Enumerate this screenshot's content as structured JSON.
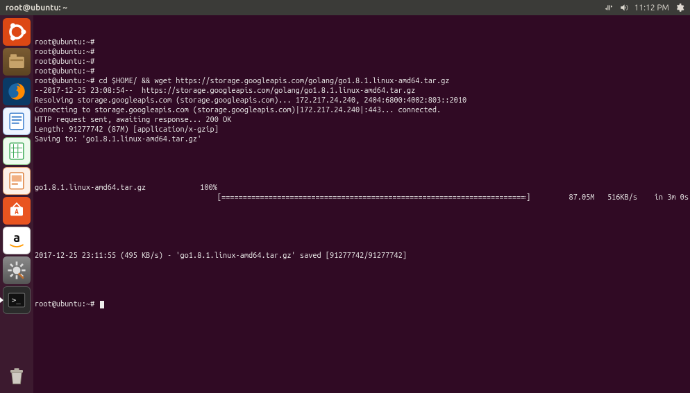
{
  "menubar": {
    "title": "root@ubuntu: ~",
    "time": "11:12 PM"
  },
  "terminal": {
    "prompt": "root@ubuntu:~#",
    "lines_before": [
      "root@ubuntu:~#",
      "root@ubuntu:~#",
      "root@ubuntu:~#",
      "root@ubuntu:~#",
      "root@ubuntu:~# cd $HOME/ && wget https://storage.googleapis.com/golang/go1.8.1.linux-amd64.tar.gz",
      "--2017-12-25 23:08:54--  https://storage.googleapis.com/golang/go1.8.1.linux-amd64.tar.gz",
      "Resolving storage.googleapis.com (storage.googleapis.com)... 172.217.24.240, 2404:6800:4002:803::2010",
      "Connecting to storage.googleapis.com (storage.googleapis.com)|172.217.24.240|:443... connected.",
      "HTTP request sent, awaiting response... 200 OK",
      "Length: 91277742 (87M) [application/x-gzip]",
      "Saving to: 'go1.8.1.linux-amd64.tar.gz'",
      ""
    ],
    "progress": {
      "filename": "go1.8.1.linux-amd64.tar.gz",
      "percent": "100%",
      "bar_open": "[",
      "bar_fill": "===================================================================================================================================>",
      "bar_close": "]",
      "size": "87.05M",
      "speed": "516KB/s",
      "eta": "in 3m 0s"
    },
    "lines_after": [
      "",
      "2017-12-25 23:11:55 (495 KB/s) - 'go1.8.1.linux-amd64.tar.gz' saved [91277742/91277742]",
      ""
    ],
    "final_prompt": "root@ubuntu:~# "
  },
  "launcher": {
    "items": [
      {
        "name": "ubuntu-dash",
        "bg": "#dd4814"
      },
      {
        "name": "files-nautilus",
        "bg": "#8a6d3b"
      },
      {
        "name": "firefox",
        "bg": "#0a3a66"
      },
      {
        "name": "libreoffice-writer",
        "bg": "#cfe4fb"
      },
      {
        "name": "libreoffice-calc",
        "bg": "#d6f5d6"
      },
      {
        "name": "libreoffice-impress",
        "bg": "#fbe0cf"
      },
      {
        "name": "ubuntu-software",
        "bg": "#e95420"
      },
      {
        "name": "amazon",
        "bg": "#ffffff"
      },
      {
        "name": "system-settings",
        "bg": "#6b6b6b"
      },
      {
        "name": "terminal",
        "bg": "#3a3a3a"
      }
    ],
    "trash": {
      "name": "trash",
      "bg": "transparent"
    }
  }
}
